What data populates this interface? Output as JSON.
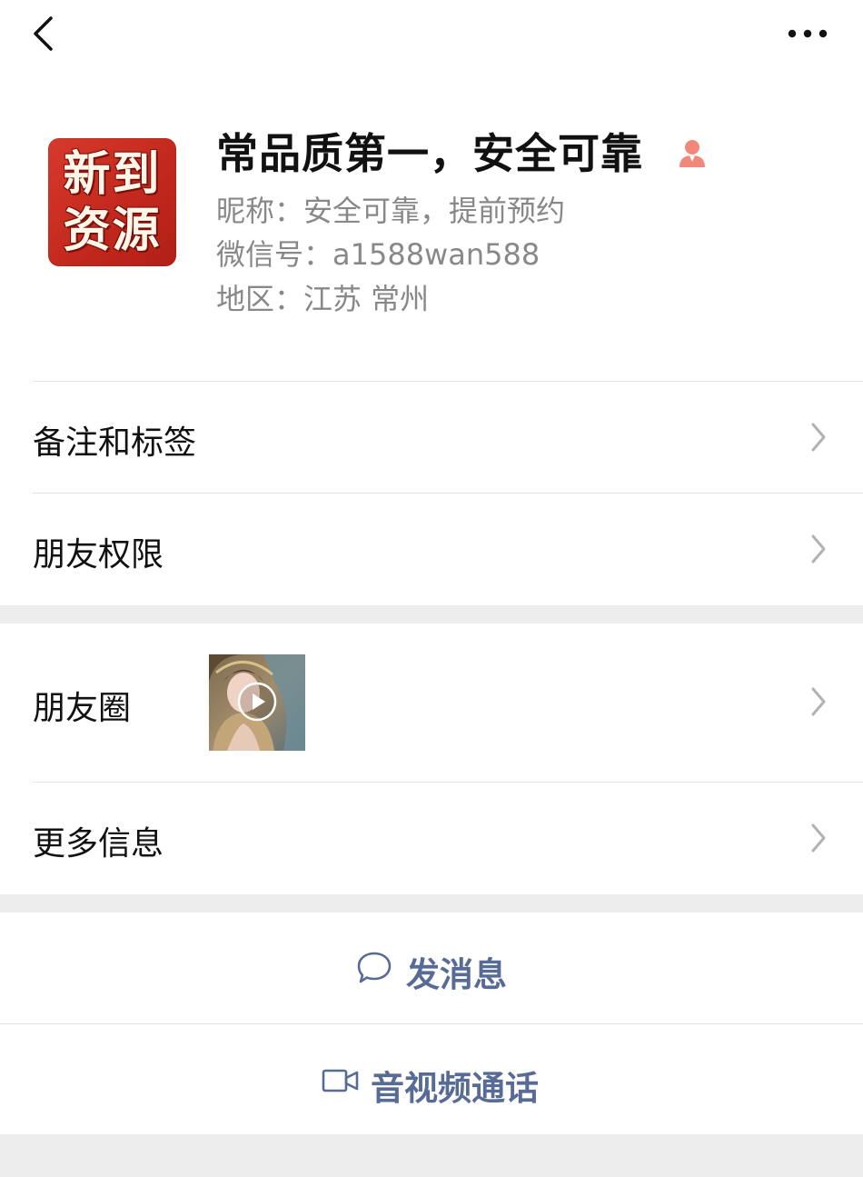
{
  "profile": {
    "avatar_text_line1": "新到",
    "avatar_text_line2": "资源",
    "name": "常品质第一，安全可靠",
    "nickname": "昵称：安全可靠，提前预约",
    "wechat_id": "微信号：a1588wan588",
    "region": "地区：江苏 常州"
  },
  "menu": {
    "remarks_tags": "备注和标签",
    "friend_permissions": "朋友权限",
    "moments": "朋友圈",
    "more_info": "更多信息"
  },
  "actions": {
    "send_message": "发消息",
    "video_call": "音视频通话"
  },
  "colors": {
    "link_blue": "#576b95",
    "gender_icon": "#f2887c",
    "background": "#ededed"
  },
  "icons": {
    "back": "chevron-left-icon",
    "more": "more-dots-icon",
    "gender": "female-icon",
    "message": "chat-bubble-icon",
    "video": "video-camera-icon",
    "play": "play-icon"
  }
}
